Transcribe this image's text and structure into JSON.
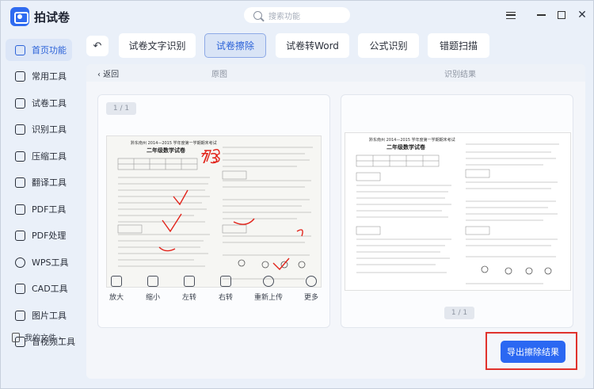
{
  "app": {
    "title": "拍试卷"
  },
  "search": {
    "placeholder": "搜索功能"
  },
  "sidebar": {
    "items": [
      {
        "label": "首页功能",
        "icon": "home-icon",
        "active": true
      },
      {
        "label": "常用工具",
        "icon": "layers-icon"
      },
      {
        "label": "试卷工具",
        "icon": "paper-icon"
      },
      {
        "label": "识别工具",
        "icon": "scan-icon"
      },
      {
        "label": "压缩工具",
        "icon": "compress-icon"
      },
      {
        "label": "翻译工具",
        "icon": "translate-icon"
      },
      {
        "label": "PDF工具",
        "icon": "pdf-icon"
      },
      {
        "label": "PDF处理",
        "icon": "pdf-process-icon"
      },
      {
        "label": "WPS工具",
        "icon": "wps-icon"
      },
      {
        "label": "CAD工具",
        "icon": "cad-icon"
      },
      {
        "label": "图片工具",
        "icon": "image-icon"
      },
      {
        "label": "音视频工具",
        "icon": "media-icon"
      }
    ],
    "my_files": "我的文件 ›"
  },
  "tabs": [
    {
      "label": "试卷文字识别"
    },
    {
      "label": "试卷擦除",
      "active": true
    },
    {
      "label": "试卷转Word"
    },
    {
      "label": "公式识别"
    },
    {
      "label": "错题扫描"
    }
  ],
  "subheader": {
    "back": "‹ 返回",
    "original": "原图",
    "result": "识别结果"
  },
  "pages": {
    "left": "1 / 1",
    "right": "1 / 1"
  },
  "paper": {
    "title1": "黔东南州 2014—2015 学年度第一学期期末考试",
    "title2": "二年级数学试卷"
  },
  "toolbar": [
    {
      "label": "放大",
      "icon": "zoom-in-icon"
    },
    {
      "label": "缩小",
      "icon": "zoom-out-icon"
    },
    {
      "label": "左转",
      "icon": "rotate-left-icon"
    },
    {
      "label": "右转",
      "icon": "rotate-right-icon"
    },
    {
      "label": "重新上传",
      "icon": "reupload-icon"
    },
    {
      "label": "更多",
      "icon": "more-icon"
    }
  ],
  "export": {
    "label": "导出擦除结果"
  },
  "colors": {
    "accent": "#2b68f2",
    "highlight": "#e0322c",
    "active_tab": "#d9e4f6"
  }
}
